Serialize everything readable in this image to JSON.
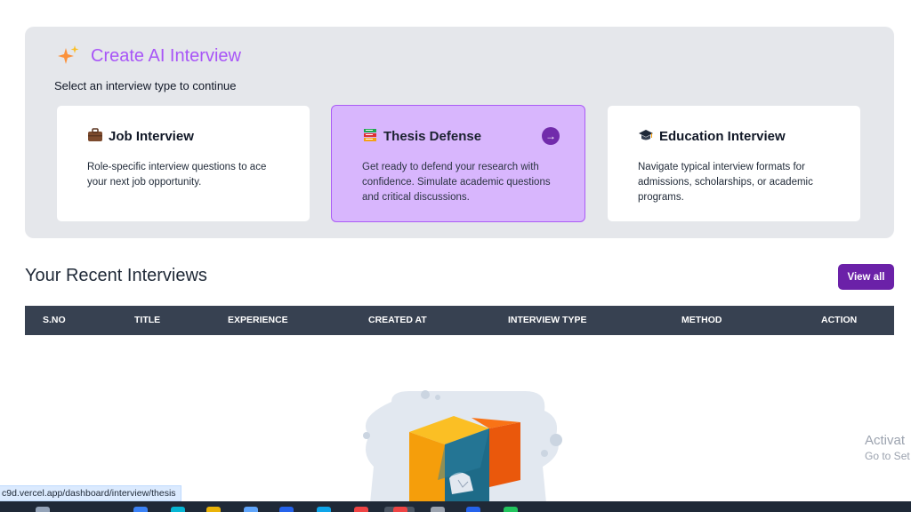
{
  "create": {
    "title": "Create AI Interview",
    "subtitle": "Select an interview type to continue",
    "cards": [
      {
        "icon": "briefcase-icon",
        "title": "Job Interview",
        "description": "Role-specific interview questions to ace your next job opportunity.",
        "selected": false
      },
      {
        "icon": "books-icon",
        "title": "Thesis Defense",
        "description": "Get ready to defend your research with confidence. Simulate academic questions and critical discussions.",
        "selected": true
      },
      {
        "icon": "graduation-cap-icon",
        "title": "Education Interview",
        "description": "Navigate typical interview formats for admissions, scholarships, or academic programs.",
        "selected": false
      }
    ]
  },
  "recent": {
    "title": "Your Recent Interviews",
    "view_all_label": "View all",
    "columns": [
      "S.NO",
      "TITLE",
      "EXPERIENCE",
      "CREATED AT",
      "INTERVIEW TYPE",
      "METHOD",
      "ACTION"
    ]
  },
  "watermark": {
    "line1": "Activat",
    "line2": "Go to Set"
  },
  "status_bar": {
    "url": "c9d.vercel.app/dashboard/interview/thesis"
  },
  "colors": {
    "accent": "#6b21a8",
    "title_purple": "#a855f7",
    "selected_card": "#d8b4fe",
    "table_header": "#374151"
  }
}
